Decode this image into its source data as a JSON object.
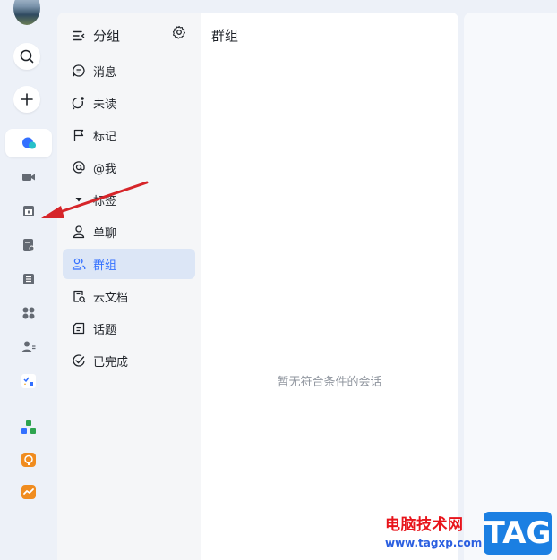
{
  "group_panel": {
    "title": "分组",
    "items": [
      {
        "label": "消息",
        "icon": "message-icon"
      },
      {
        "label": "未读",
        "icon": "unread-icon"
      },
      {
        "label": "标记",
        "icon": "flag-icon"
      },
      {
        "label": "@我",
        "icon": "at-icon"
      },
      {
        "label": "标签",
        "icon": "caret-down-icon"
      },
      {
        "label": "单聊",
        "icon": "user-icon"
      },
      {
        "label": "群组",
        "icon": "group-icon"
      },
      {
        "label": "云文档",
        "icon": "cloud-doc-icon"
      },
      {
        "label": "话题",
        "icon": "topic-icon"
      },
      {
        "label": "已完成",
        "icon": "check-circle-icon"
      }
    ],
    "active_item": "群组"
  },
  "conversation_list": {
    "title": "群组",
    "empty_text": "暂无符合条件的会话"
  },
  "colors": {
    "accent": "#3370ff",
    "active_bg": "#dce6f6",
    "arrow": "#d6252a"
  },
  "watermark": {
    "cn_text": "电脑技术网",
    "url": "www.tagxp.com",
    "badge": "TAG"
  }
}
